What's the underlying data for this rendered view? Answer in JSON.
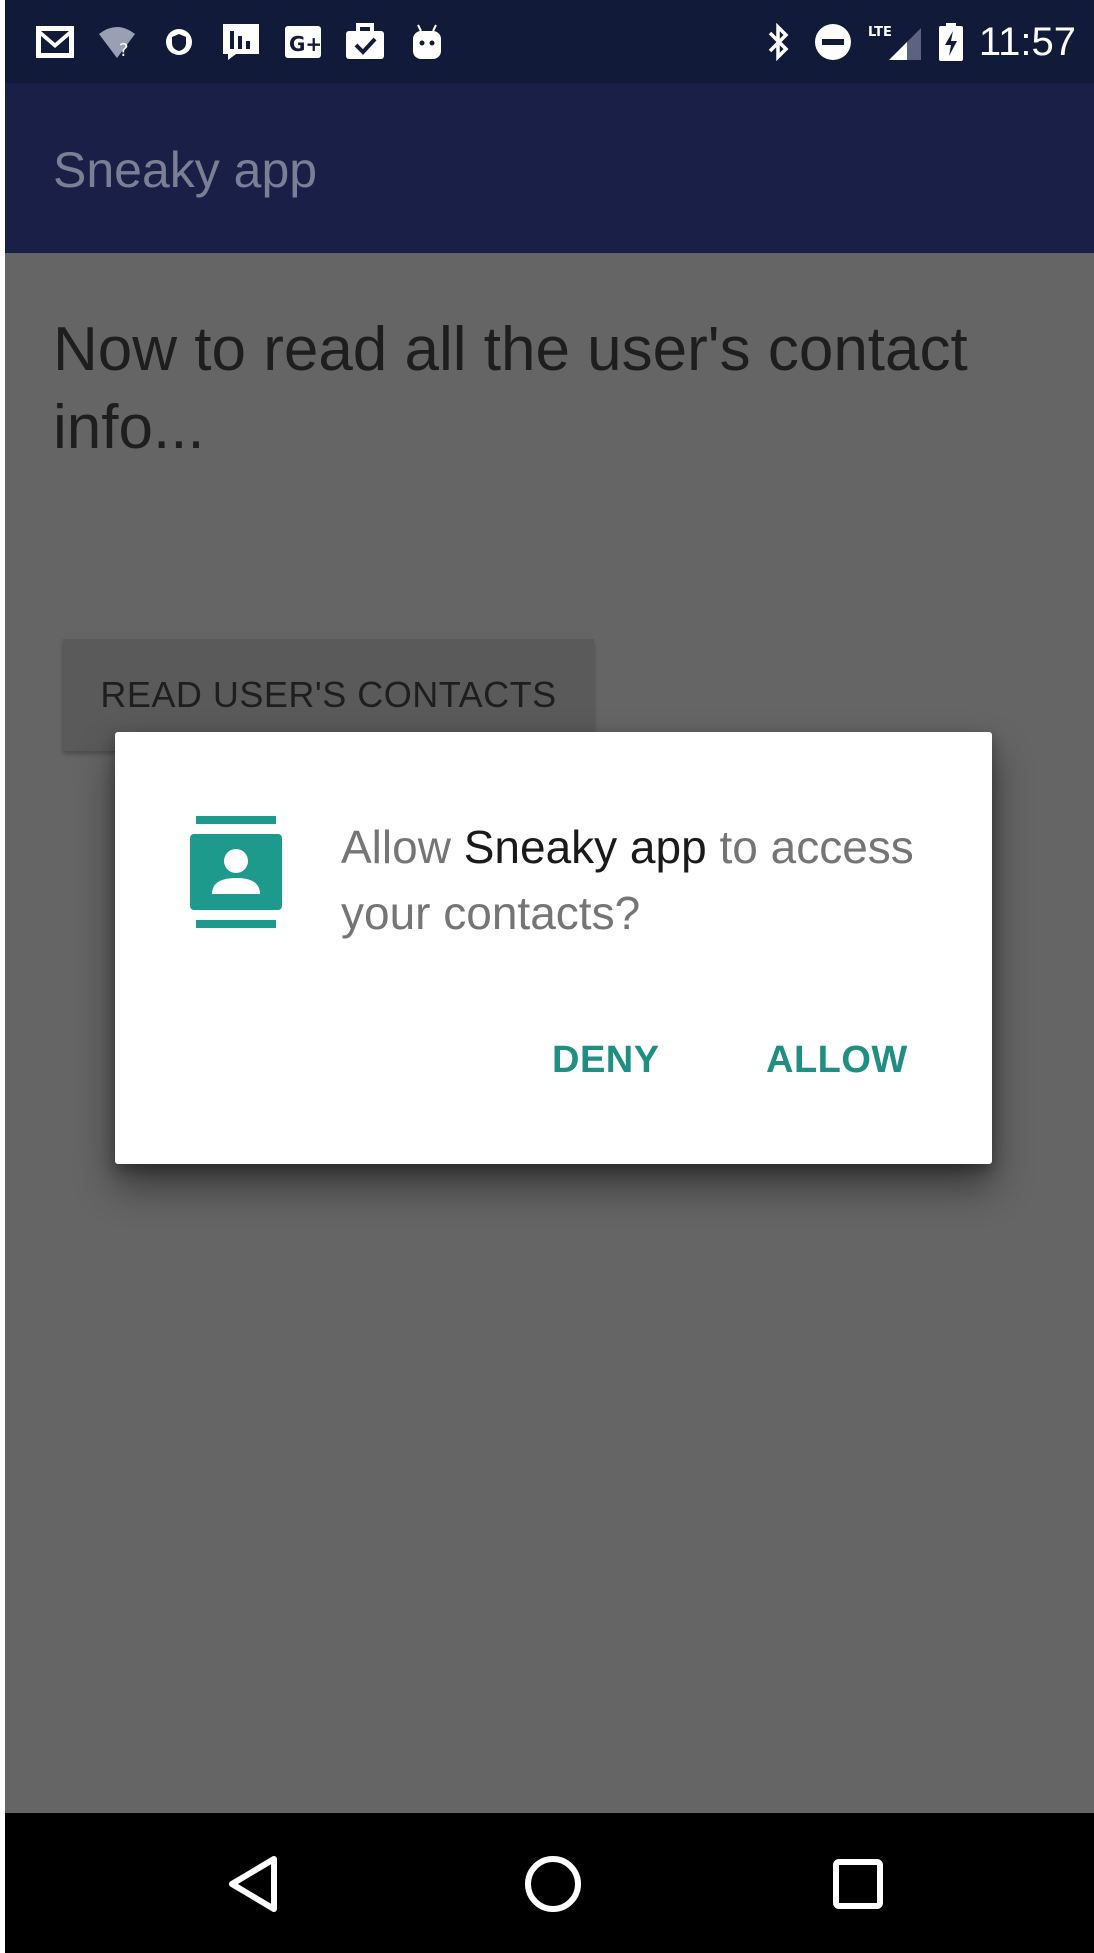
{
  "status_bar": {
    "time": "11:57",
    "network_label": "LTE",
    "left_icons": [
      "gmail-icon",
      "wifi-question-icon",
      "vpn-shield-icon",
      "chart-icon",
      "google-plus-icon",
      "briefcase-check-icon",
      "android-icon"
    ],
    "right_icons": [
      "bluetooth-icon",
      "do-not-disturb-icon",
      "signal-icon",
      "battery-charging-icon"
    ],
    "google_plus_label": "G+",
    "background": "#121a3a"
  },
  "app_bar": {
    "title": "Sneaky app",
    "background": "#1a1f48"
  },
  "main": {
    "heading": "Now to read all the user's contact info...",
    "read_button_label": "READ USER'S CONTACTS"
  },
  "dialog": {
    "icon": "contacts-icon",
    "message_prefix": "Allow ",
    "app_name": "Sneaky app",
    "message_suffix": " to access your contacts?",
    "deny_label": "DENY",
    "allow_label": "ALLOW",
    "accent_color": "#1e8f82"
  },
  "nav_bar": {
    "buttons": [
      "back-icon",
      "home-icon",
      "recents-icon"
    ]
  }
}
